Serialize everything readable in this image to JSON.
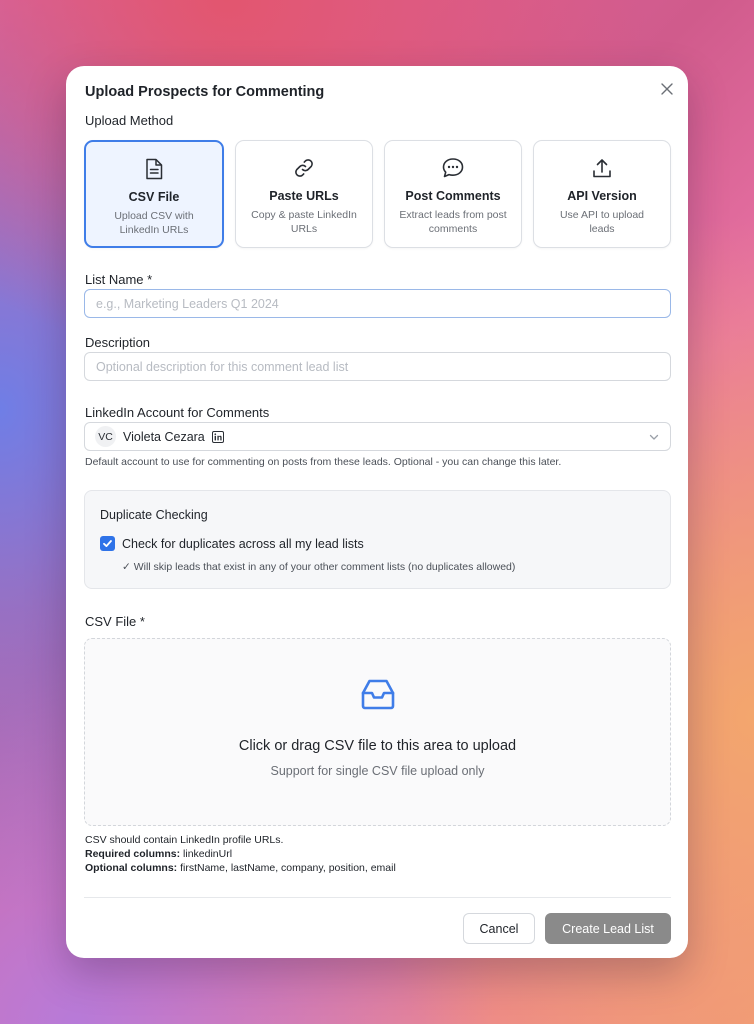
{
  "dialog": {
    "title": "Upload Prospects for Commenting",
    "close_icon": "close-icon"
  },
  "upload_method": {
    "label": "Upload Method",
    "selected": "csv",
    "options": [
      {
        "id": "csv",
        "icon": "file-text-icon",
        "title": "CSV File",
        "description": "Upload CSV with LinkedIn URLs"
      },
      {
        "id": "urls",
        "icon": "link-icon",
        "title": "Paste URLs",
        "description": "Copy & paste LinkedIn URLs"
      },
      {
        "id": "comments",
        "icon": "chat-bubbles-icon",
        "title": "Post Comments",
        "description": "Extract leads from post comments"
      },
      {
        "id": "api",
        "icon": "upload-icon",
        "title": "API Version",
        "description": "Use API to upload leads"
      }
    ]
  },
  "list_name": {
    "label": "List Name *",
    "value": "",
    "placeholder": "e.g., Marketing Leaders Q1 2024"
  },
  "description": {
    "label": "Description",
    "value": "",
    "placeholder": "Optional description for this comment lead list"
  },
  "linkedin_account": {
    "label": "LinkedIn Account for Comments",
    "avatar_initials": "VC",
    "selected_name": "Violeta Cezara",
    "badge_icon": "linkedin-icon",
    "hint": "Default account to use for commenting on posts from these leads. Optional - you can change this later."
  },
  "duplicate_checking": {
    "title": "Duplicate Checking",
    "checked": true,
    "checkbox_label": "Check for duplicates across all my lead lists",
    "note": "✓ Will skip leads that exist in any of your other comment lists (no duplicates allowed)"
  },
  "csv_file": {
    "label": "CSV File *",
    "dropzone_title": "Click or drag CSV file to this area to upload",
    "dropzone_subtitle": "Support for single CSV file upload only",
    "help_line": "CSV should contain LinkedIn profile URLs.",
    "required_label": "Required columns:",
    "required_value": "linkedinUrl",
    "optional_label": "Optional columns:",
    "optional_value": "firstName, lastName, company, position, email"
  },
  "footer": {
    "cancel_label": "Cancel",
    "create_label": "Create Lead List"
  },
  "colors": {
    "accent": "#3f7de8",
    "selected_bg": "#eef4ff",
    "disabled_button": "#8a8a8a"
  }
}
